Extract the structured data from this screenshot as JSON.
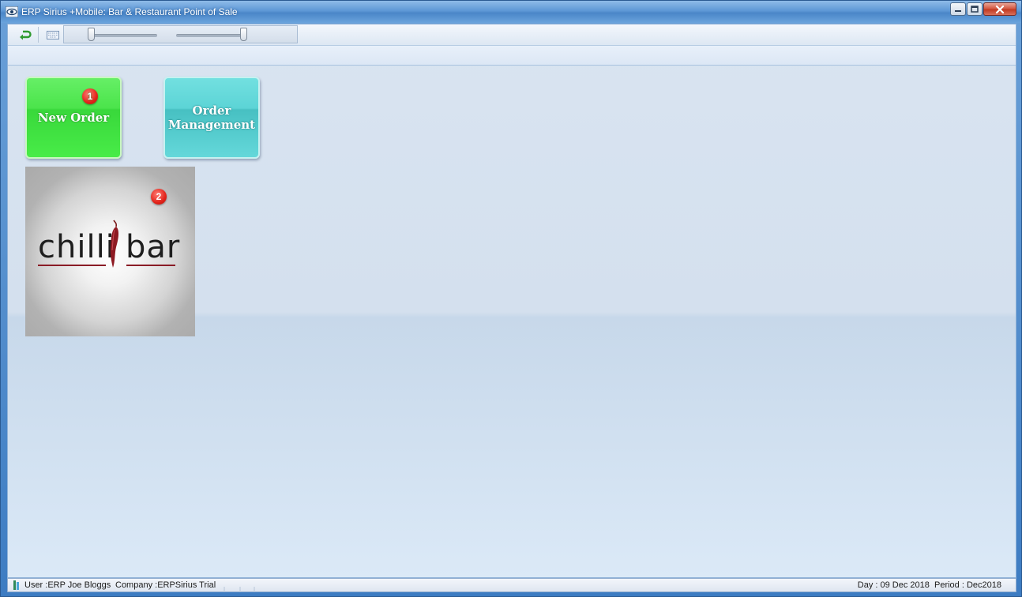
{
  "window": {
    "title": "ERP Sirius +Mobile: Bar & Restaurant Point of Sale",
    "controls": [
      "minimize",
      "maximize",
      "close"
    ]
  },
  "toolbar": {
    "icons": [
      "back-arrow-icon",
      "keyboard-icon"
    ],
    "sliders": [
      {
        "name": "slider-1",
        "level": 0.05
      },
      {
        "name": "slider-2",
        "level": 0.95
      }
    ]
  },
  "tiles": {
    "new_order": {
      "label": "New Order",
      "badge": "1",
      "color": "#4be44b"
    },
    "order_management": {
      "label": "Order\nManagement",
      "color": "#5cd4d6"
    },
    "logo": {
      "brand_left": "chilli",
      "brand_right": "bar",
      "badge": "2",
      "accent": "#8a1c26"
    }
  },
  "status": {
    "user": "User :ERP Joe Bloggs",
    "company": "Company :ERPSirius Trial",
    "day_period": "Day : 09 Dec 2018  Period : Dec2018"
  }
}
